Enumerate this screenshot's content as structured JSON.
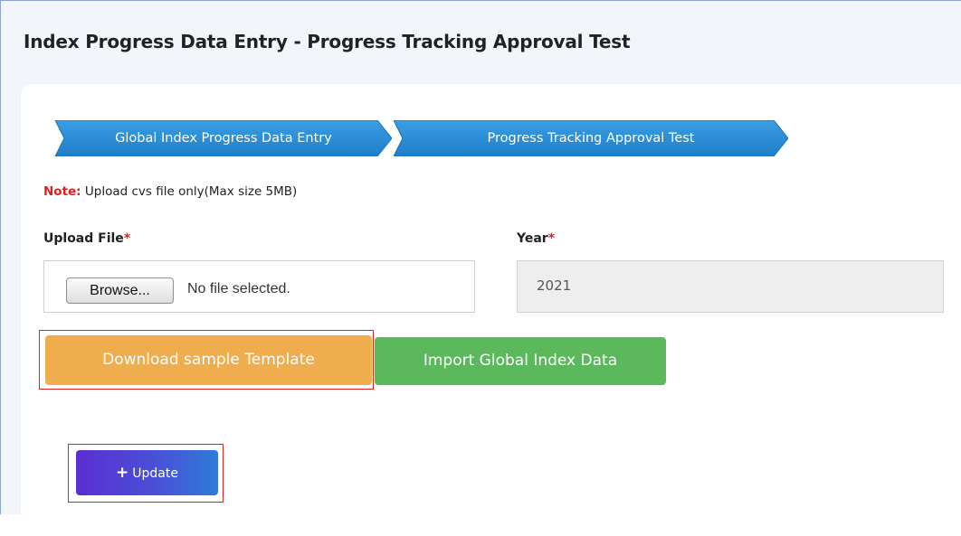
{
  "page_title": "Index Progress Data Entry - Progress Tracking Approval Test",
  "breadcrumb": [
    {
      "label": "Global Index Progress Data Entry"
    },
    {
      "label": "Progress Tracking Approval Test"
    }
  ],
  "note": {
    "label": "Note:",
    "text": " Upload cvs file only(Max size 5MB)"
  },
  "upload": {
    "label": "Upload File",
    "required_marker": "*",
    "browse_label": "Browse...",
    "status": "No file selected."
  },
  "year": {
    "label": "Year",
    "required_marker": "*",
    "value": "2021"
  },
  "buttons": {
    "download": "Download sample Template",
    "import": "Import Global Index Data",
    "update_icon": "+",
    "update": "Update"
  },
  "colors": {
    "breadcrumb_blue": "#2b8fd6",
    "download_orange": "#efad4d",
    "import_green": "#5cb85c",
    "required_red": "#e0201b",
    "highlight_red": "#e0201b"
  },
  "icons": {
    "update": "plus-icon"
  }
}
